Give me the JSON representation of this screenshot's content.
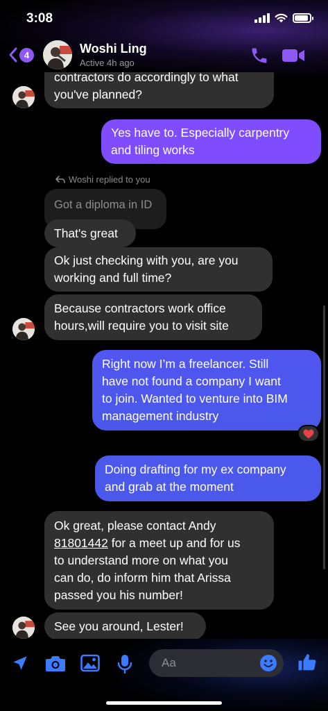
{
  "status_bar": {
    "time": "3:08",
    "battery_level": 0.9
  },
  "header": {
    "back_badge": "4",
    "contact_name": "Woshi Ling",
    "active_status": "Active 4h ago",
    "accent_color": "#8e58f5"
  },
  "messages": {
    "m1": {
      "lines": [
        "contractors do accordingly to what",
        "you've planned?"
      ],
      "sender": "Woshi Ling"
    },
    "m2": {
      "lines": [
        "Yes have to. Especially carpentry",
        "and tiling works"
      ],
      "sender": "me"
    },
    "reply_label": "Woshi replied to you",
    "m3_quoted": {
      "text": "Got a diploma in ID"
    },
    "m4": {
      "text": "That's great"
    },
    "m5": {
      "lines": [
        "Ok just checking with you, are you",
        "working and full time?"
      ]
    },
    "m6": {
      "lines": [
        "Because contractors work office",
        "hours,will require you to visit site"
      ]
    },
    "m7": {
      "lines": [
        "Right now I’m a freelancer. Still",
        "have not found a company I want",
        "to join. Wanted to venture into BIM",
        "management industry"
      ],
      "reaction": "heart"
    },
    "m8": {
      "lines": [
        "Doing drafting for my ex company",
        "and grab at the moment"
      ]
    },
    "m9": {
      "line1_prefix": "Ok great, please contact Andy",
      "phone": "81801442",
      "line2_suffix": " for a meet up and for us",
      "lines_rest": [
        "to understand more on what you",
        "can do, do inform him that Arissa",
        "passed you his number!"
      ]
    },
    "m10": {
      "text": "See you around, Lester!"
    }
  },
  "composer": {
    "placeholder": "Aa",
    "icons": [
      "location-icon",
      "camera-icon",
      "gallery-icon",
      "microphone-icon",
      "emoji-icon",
      "thumbs-up-icon"
    ],
    "icon_color": "#3a7bff"
  },
  "colors": {
    "incoming_bubble": "#303030",
    "outgoing_purple": "#7f4dff",
    "outgoing_blue": "#4b58ec"
  }
}
